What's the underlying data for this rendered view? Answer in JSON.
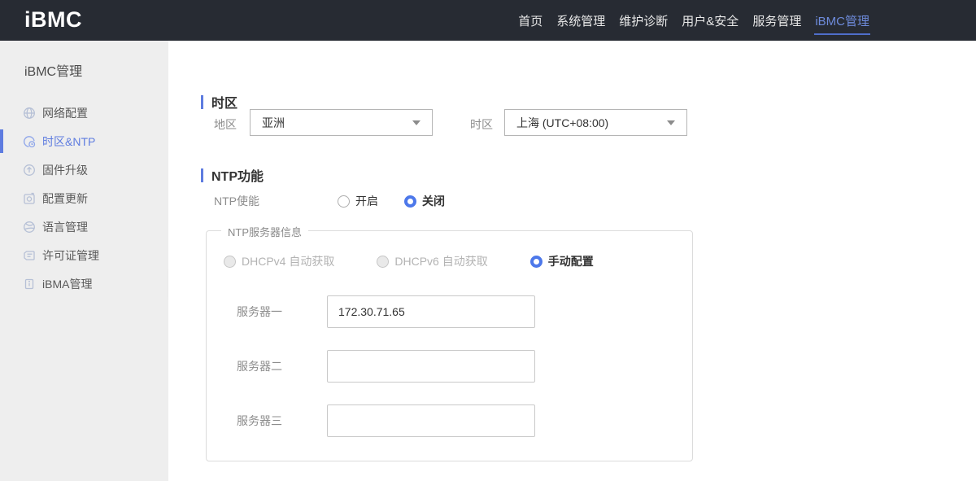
{
  "navbar": {
    "logo": "iBMC",
    "items": [
      {
        "label": "首页",
        "active": false
      },
      {
        "label": "系统管理",
        "active": false
      },
      {
        "label": "维护诊断",
        "active": false
      },
      {
        "label": "用户&安全",
        "active": false
      },
      {
        "label": "服务管理",
        "active": false
      },
      {
        "label": "iBMC管理",
        "active": true
      }
    ]
  },
  "sidebar": {
    "title": "iBMC管理",
    "items": [
      {
        "label": "网络配置",
        "icon": "globe-icon",
        "active": false
      },
      {
        "label": "时区&NTP",
        "icon": "timezone-clock-icon",
        "active": true
      },
      {
        "label": "固件升级",
        "icon": "firmware-upgrade-icon",
        "active": false
      },
      {
        "label": "配置更新",
        "icon": "config-update-icon",
        "active": false
      },
      {
        "label": "语言管理",
        "icon": "language-icon",
        "active": false
      },
      {
        "label": "许可证管理",
        "icon": "license-icon",
        "active": false
      },
      {
        "label": "iBMA管理",
        "icon": "ibma-icon",
        "active": false
      }
    ],
    "collapse_icon": "chevron-left-icon"
  },
  "main": {
    "timezone_section": {
      "title": "时区",
      "region_label": "地区",
      "region_value": "亚洲",
      "timezone_label": "时区",
      "timezone_value": "上海 (UTC+08:00)"
    },
    "ntp_section": {
      "title": "NTP功能",
      "enable_label": "NTP使能",
      "enable_options": [
        {
          "label": "开启",
          "selected": false
        },
        {
          "label": "关闭",
          "selected": true
        }
      ],
      "server_group": {
        "legend": "NTP服务器信息",
        "mode_options": [
          {
            "label": "DHCPv4 自动获取",
            "selected": false,
            "disabled": true
          },
          {
            "label": "DHCPv6 自动获取",
            "selected": false,
            "disabled": true
          },
          {
            "label": "手动配置",
            "selected": true,
            "disabled": false
          }
        ],
        "servers": [
          {
            "label": "服务器一",
            "value": "172.30.71.65"
          },
          {
            "label": "服务器二",
            "value": ""
          },
          {
            "label": "服务器三",
            "value": ""
          }
        ]
      }
    }
  },
  "colors": {
    "navbar_bg": "#272b33",
    "sidebar_bg": "#eeeeee",
    "accent_blue": "#5e7ce0",
    "nav_active_text": "#6e8bdb",
    "radio_checked": "#4d78ea"
  }
}
